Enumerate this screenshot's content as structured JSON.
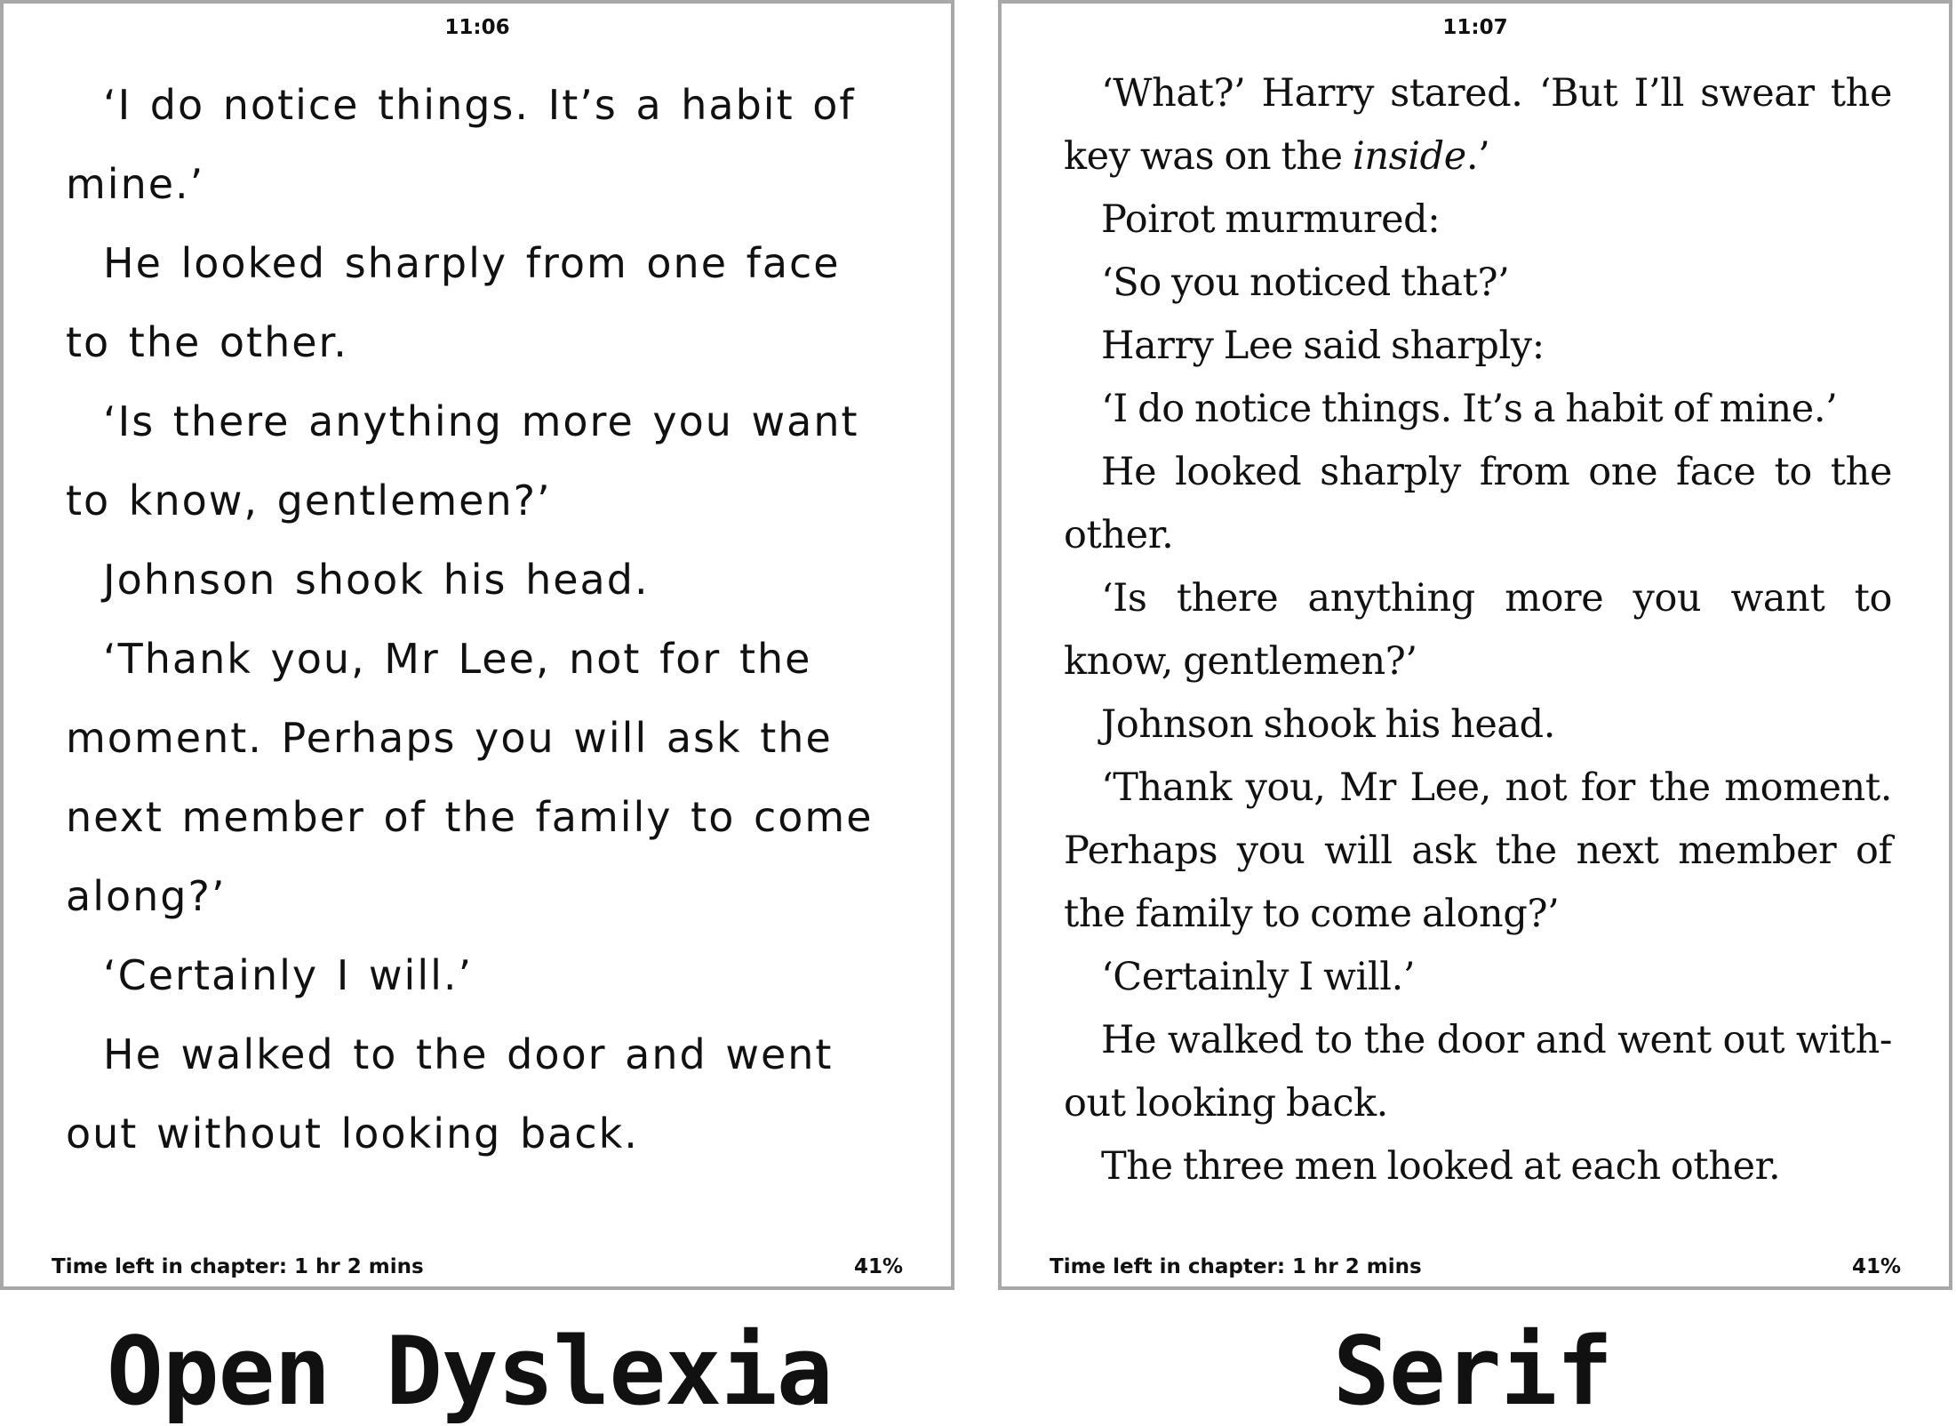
{
  "left_panel": {
    "time": "11:06",
    "paragraphs": [
      "‘I do notice things. It’s a habit of mine.’",
      "He looked sharply from one face to the other.",
      "‘Is there anything more you want to know, gentlemen?’",
      "Johnson shook his head.",
      "‘Thank you, Mr Lee, not for the moment. Perhaps you will ask the next member of the family to come along?’",
      "‘Certainly I will.’",
      "He walked to the door and went out without looking back."
    ],
    "footer": {
      "time_left": "Time left in chapter: 1 hr 2 mins",
      "progress": "41%"
    },
    "caption": "Open Dyslexia"
  },
  "right_panel": {
    "time": "11:07",
    "paragraphs": [
      "‘What?’ Harry stared. ‘But I’ll swear the key was on the ",
      "Poirot murmured:",
      "‘So you noticed that?’",
      "Harry Lee said sharply:",
      "‘I do notice things. It’s a habit of mine.’",
      "He looked sharply from one face to the other.",
      "‘Is there anything more you want to know, gentlemen?’",
      "Johnson shook his head.",
      "‘Thank you, Mr Lee, not for the moment. Perhaps you will ask the next member of the family to come along?’",
      "‘Certainly I will.’",
      "He walked to the door and went out with-out looking back.",
      "The three men looked at each other."
    ],
    "first_paragraph_italic": "inside",
    "first_paragraph_end": ".’",
    "footer": {
      "time_left": "Time left in chapter: 1 hr 2 mins",
      "progress": "41%"
    },
    "caption": "Serif"
  }
}
